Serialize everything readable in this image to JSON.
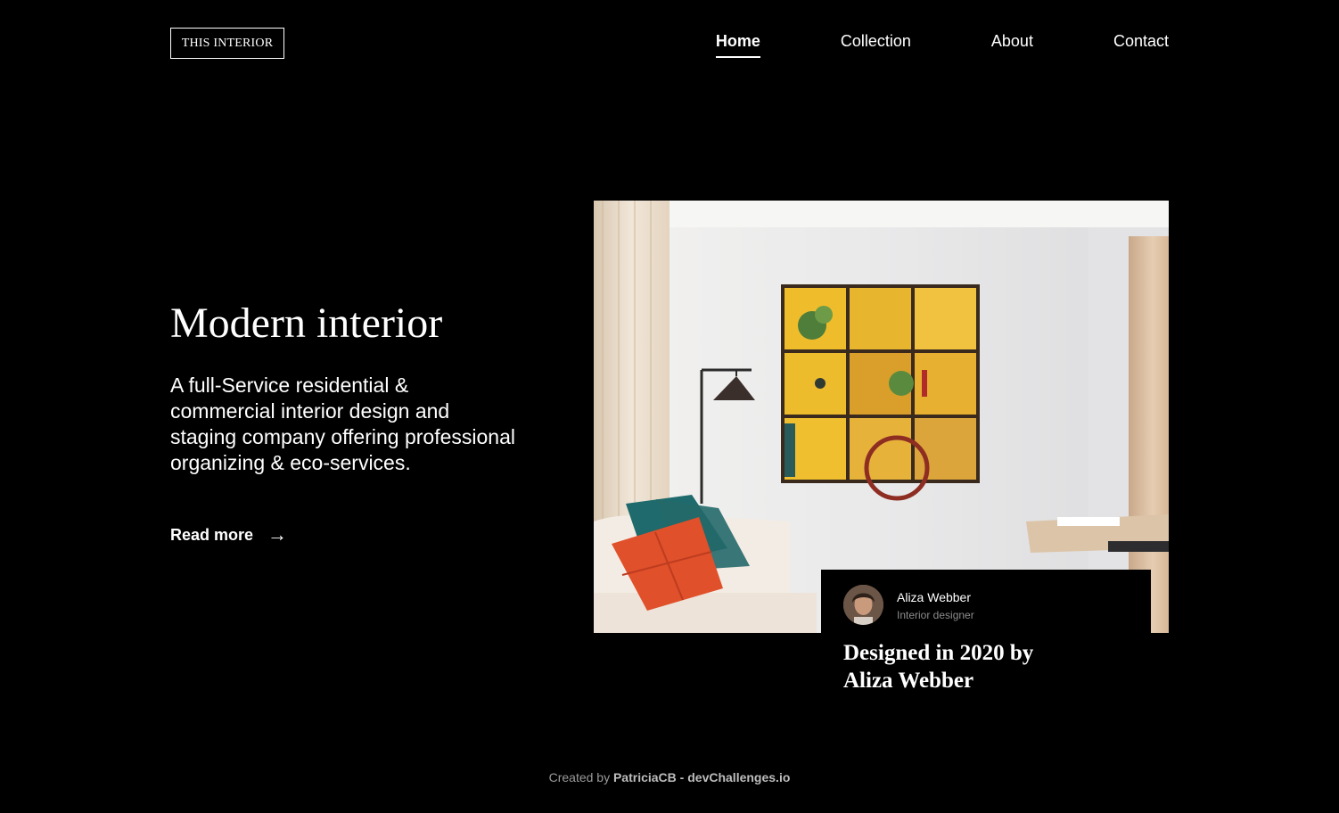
{
  "header": {
    "logo": "THIS INTERIOR",
    "nav": [
      {
        "label": "Home",
        "active": true
      },
      {
        "label": "Collection",
        "active": false
      },
      {
        "label": "About",
        "active": false
      },
      {
        "label": "Contact",
        "active": false
      }
    ]
  },
  "hero": {
    "title": "Modern interior",
    "description": "A full-Service residential & commercial interior design and staging company offering professional organizing & eco-services.",
    "read_more": "Read more",
    "arrow": "→"
  },
  "card": {
    "author_name": "Aliza Webber",
    "author_role": "Interior designer",
    "title": "Designed in 2020 by Aliza Webber"
  },
  "footer": {
    "prefix": "Created by",
    "author": "PatriciaCB",
    "separator": "-",
    "site": "devChallenges.io"
  }
}
